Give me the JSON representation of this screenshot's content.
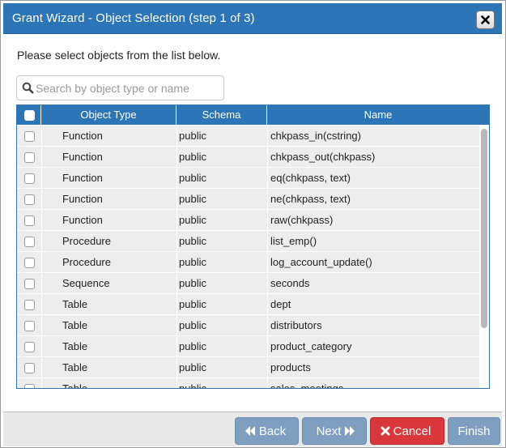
{
  "dialog": {
    "title": "Grant Wizard - Object Selection (step 1 of 3)",
    "close_icon": "close-x-icon"
  },
  "intro_text": "Please select objects from the list below.",
  "search": {
    "placeholder": "Search by object type or name",
    "value": "",
    "icon": "search-icon"
  },
  "table": {
    "columns": [
      "Object Type",
      "Schema",
      "Name"
    ],
    "rows": [
      {
        "type": "Function",
        "schema": "public",
        "name": "chkpass_in(cstring)",
        "checked": false
      },
      {
        "type": "Function",
        "schema": "public",
        "name": "chkpass_out(chkpass)",
        "checked": false
      },
      {
        "type": "Function",
        "schema": "public",
        "name": "eq(chkpass, text)",
        "checked": false
      },
      {
        "type": "Function",
        "schema": "public",
        "name": "ne(chkpass, text)",
        "checked": false
      },
      {
        "type": "Function",
        "schema": "public",
        "name": "raw(chkpass)",
        "checked": false
      },
      {
        "type": "Procedure",
        "schema": "public",
        "name": "list_emp()",
        "checked": false
      },
      {
        "type": "Procedure",
        "schema": "public",
        "name": "log_account_update()",
        "checked": false
      },
      {
        "type": "Sequence",
        "schema": "public",
        "name": "seconds",
        "checked": false
      },
      {
        "type": "Table",
        "schema": "public",
        "name": "dept",
        "checked": false
      },
      {
        "type": "Table",
        "schema": "public",
        "name": "distributors",
        "checked": false
      },
      {
        "type": "Table",
        "schema": "public",
        "name": "product_category",
        "checked": false
      },
      {
        "type": "Table",
        "schema": "public",
        "name": "products",
        "checked": false
      },
      {
        "type": "Table",
        "schema": "public",
        "name": "sales_meetings",
        "checked": false
      }
    ]
  },
  "buttons": {
    "back": "Back",
    "next": "Next",
    "cancel": "Cancel",
    "finish": "Finish"
  },
  "colors": {
    "accent": "#2c76b8",
    "nav_button": "#7f9fc0",
    "cancel_button": "#d9373a",
    "row_background": "#ededed"
  }
}
